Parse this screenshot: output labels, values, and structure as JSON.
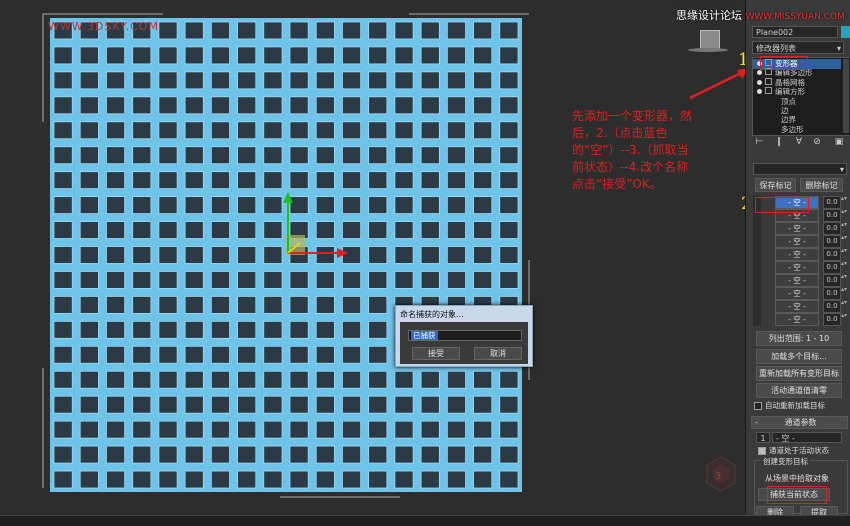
{
  "viewport": {
    "watermark": "WWW.3DSKY.COM",
    "grid": {
      "cols": 18,
      "rows": 19,
      "bar_color": "#6ec3e8"
    }
  },
  "site_mark": {
    "brand": "思缘设计论坛",
    "url": "WWW.MISSYUAN.COM"
  },
  "instruction": "先添加一个变形器，然后，2.（点击蓝色的“空”）--3.（抓取当前状态）--4.改个名称点击“接受”OK。",
  "steps": [
    "1",
    "2",
    "3",
    "4"
  ],
  "panel": {
    "object_name": "Plane002",
    "object_color": "#2aa0c0",
    "modifier_list": "修改器列表",
    "stack": [
      {
        "label": "变形器",
        "selected": true,
        "level": 0
      },
      {
        "label": "编辑多边形",
        "selected": false,
        "level": 0
      },
      {
        "label": "晶格网格",
        "selected": false,
        "level": 0
      },
      {
        "label": "编辑方形",
        "selected": false,
        "level": 0
      },
      {
        "label": "顶点",
        "selected": false,
        "level": 1
      },
      {
        "label": "边",
        "selected": false,
        "level": 1
      },
      {
        "label": "边界",
        "selected": false,
        "level": 1
      },
      {
        "label": "多边形",
        "selected": false,
        "level": 1
      }
    ],
    "save_mark": "保存标记",
    "delete_mark": "删除标记",
    "channels": [
      {
        "name": "- 空 -",
        "value": "0.0",
        "active": true
      },
      {
        "name": "- 空 -",
        "value": "0.0",
        "active": false
      },
      {
        "name": "- 空 -",
        "value": "0.0",
        "active": false
      },
      {
        "name": "- 空 -",
        "value": "0.0",
        "active": false
      },
      {
        "name": "- 空 -",
        "value": "0.0",
        "active": false
      },
      {
        "name": "- 空 -",
        "value": "0.0",
        "active": false
      },
      {
        "name": "- 空 -",
        "value": "0.0",
        "active": false
      },
      {
        "name": "- 空 -",
        "value": "0.0",
        "active": false
      },
      {
        "name": "- 空 -",
        "value": "0.0",
        "active": false
      },
      {
        "name": "- 空 -",
        "value": "0.0",
        "active": false
      }
    ],
    "list_range": "列出范围:   1 - 10",
    "load_multiple": "加载多个目标...",
    "reload_all": "重新加载所有变形目标",
    "zero_active": "活动通道值清零",
    "auto_reload": "自动重新加载目标",
    "section_title": "通道参数",
    "channel_number": "1",
    "channel_name": "- 空 -",
    "channel_active": "通道处于活动状态",
    "create_group": "创建变形目标",
    "pick_from_scene": "从场景中拾取对象",
    "capture_state": "捕获当前状态",
    "delete": "删除",
    "extract": "提取"
  },
  "dialog": {
    "title": "命名捕获的对象...",
    "input_value": "已捕获",
    "ok": "接受",
    "cancel": "取消"
  }
}
